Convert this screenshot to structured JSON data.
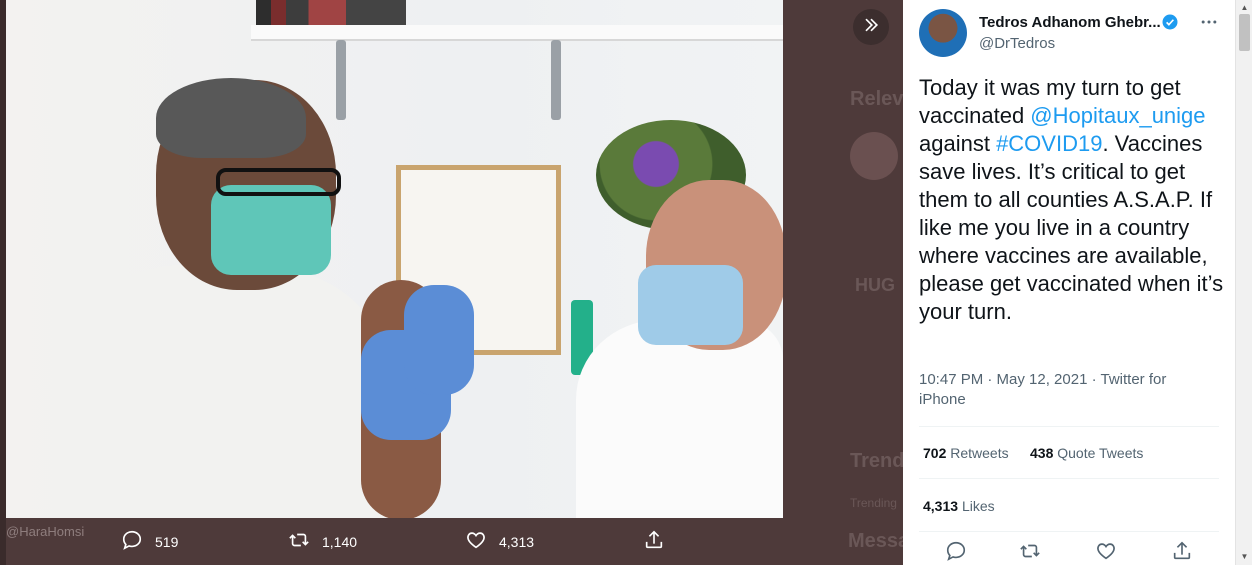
{
  "photo": {
    "watermark": "@HaraHomsi"
  },
  "image_actions": {
    "replies": "519",
    "retweets": "1,140",
    "likes": "4,313"
  },
  "background": {
    "relevant": "Relev",
    "trends": "Trend",
    "trending": "Trending",
    "messages": "Messa",
    "hug": "HUG"
  },
  "tweet": {
    "name": "Tedros Adhanom Ghebr...",
    "handle": "@DrTedros",
    "text_1": "Today it was my turn to get vaccinated ",
    "mention": "@Hopitaux_unige",
    "text_2": " against ",
    "hashtag": "#COVID19",
    "text_3": ". Vaccines save lives. It’s critical to get them to all counties A.S.A.P. If like me you live in a country where vaccines are available, please get vaccinated when it’s your turn.",
    "timestamp": "10:47 PM · May 12, 2021 · Twitter for iPhone",
    "retweets_count": "702",
    "retweets_label": "Retweets",
    "quote_count": "438",
    "quote_label": "Quote Tweets",
    "likes_count": "4,313",
    "likes_label": "Likes"
  },
  "colors": {
    "accent": "#1d9bf0",
    "overlay": "#4e3a3a",
    "text": "#0f1419",
    "muted": "#536471"
  },
  "icons": [
    "reply-icon",
    "retweet-icon",
    "like-icon",
    "share-icon",
    "expand-icon",
    "more-icon",
    "verified-icon"
  ]
}
